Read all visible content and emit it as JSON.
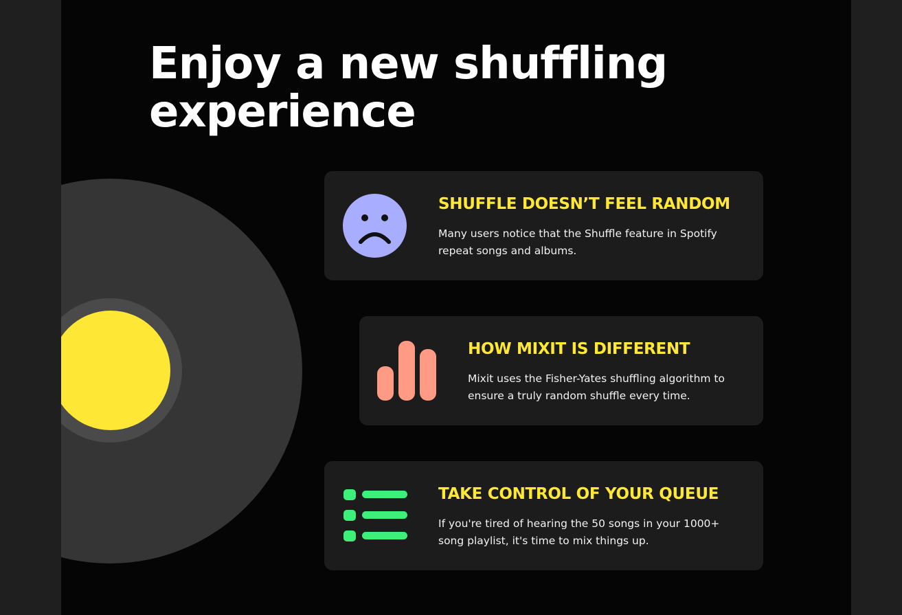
{
  "page": {
    "title": "Enjoy a new shuffling experience"
  },
  "cards": [
    {
      "heading": "SHUFFLE DOESN’T FEEL RANDOM",
      "body": "Many users notice that the Shuffle feature in Spotify repeat songs and albums.",
      "icon": "sad-face-icon",
      "icon_color": "#a9adff"
    },
    {
      "heading": "HOW MIXIT IS DIFFERENT",
      "body": "Mixit uses the Fisher-Yates shuffling algorithm to ensure a truly random shuffle every time.",
      "icon": "bar-chart-icon",
      "icon_color": "#ff9a85"
    },
    {
      "heading": "TAKE CONTROL OF YOUR QUEUE",
      "body": "If you're tired of hearing the 50 songs in your 1000+ song playlist, it's time to mix things up.",
      "icon": "queue-list-icon",
      "icon_color": "#3cf07a"
    }
  ],
  "colors": {
    "background": "#050505",
    "side_margin": "#1f1f1f",
    "card": "#1c1c1c",
    "accent_yellow": "#ffe835",
    "vinyl": "#353535"
  }
}
